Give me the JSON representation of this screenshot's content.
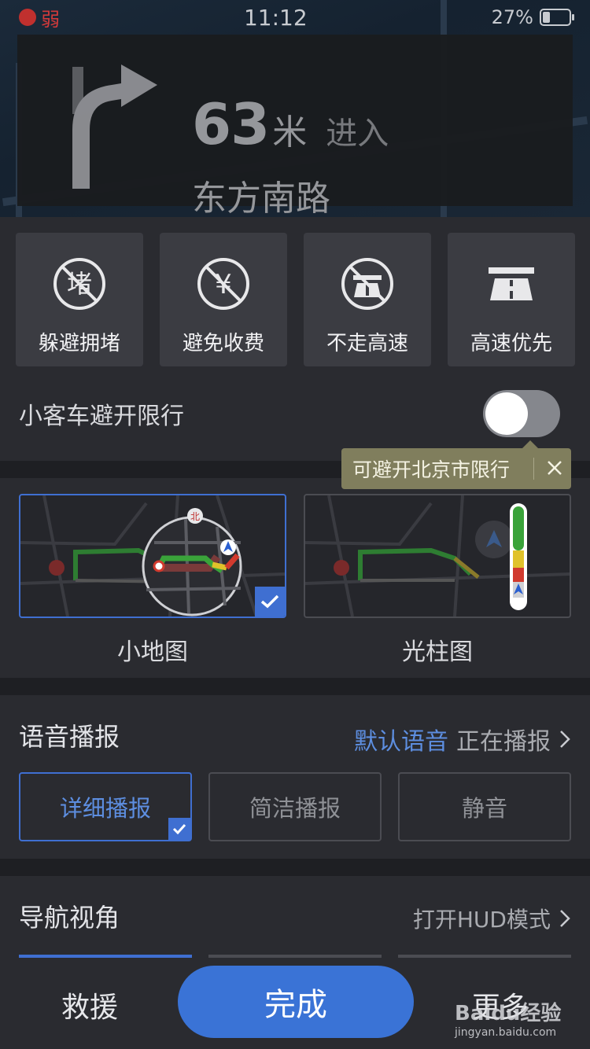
{
  "status_bar": {
    "signal_text": "弱",
    "time": "11:12",
    "battery_text": "27%",
    "battery_level": 0.27
  },
  "guide": {
    "distance": "63",
    "unit": "米",
    "action": "进入",
    "road": "东方南路",
    "turn_icon": "turn-right-arrow-icon"
  },
  "preferences": [
    {
      "label": "躲避拥堵",
      "icon": "avoid-congestion-icon",
      "glyph": "堵"
    },
    {
      "label": "避免收费",
      "icon": "avoid-toll-icon",
      "glyph": "¥"
    },
    {
      "label": "不走高速",
      "icon": "no-highway-icon",
      "glyph": ""
    },
    {
      "label": "高速优先",
      "icon": "highway-first-icon",
      "glyph": ""
    }
  ],
  "restriction": {
    "label": "小客车避开限行",
    "toggle_on": false,
    "tooltip": "可避开北京市限行"
  },
  "map_options": [
    {
      "caption": "小地图",
      "selected": true,
      "north_mark": "北"
    },
    {
      "caption": "光柱图",
      "selected": false
    }
  ],
  "voice": {
    "title": "语音播报",
    "voice_name": "默认语音",
    "status": "正在播报",
    "modes": [
      "详细播报",
      "简洁播报",
      "静音"
    ],
    "selected_mode": 0
  },
  "view": {
    "title": "导航视角",
    "hud_link": "打开HUD模式"
  },
  "bottom": {
    "rescue": "救援",
    "done": "完成",
    "more": "更多"
  },
  "watermark": {
    "line1": "Baidu经验",
    "line2": "jingyan.baidu.com"
  },
  "colors": {
    "accent": "#3a73d6",
    "link": "#5d8ee0",
    "tooltip": "#807e5d",
    "traffic_green": "#3aa33a",
    "traffic_yellow": "#e0c22a",
    "traffic_red": "#d13a2e"
  }
}
